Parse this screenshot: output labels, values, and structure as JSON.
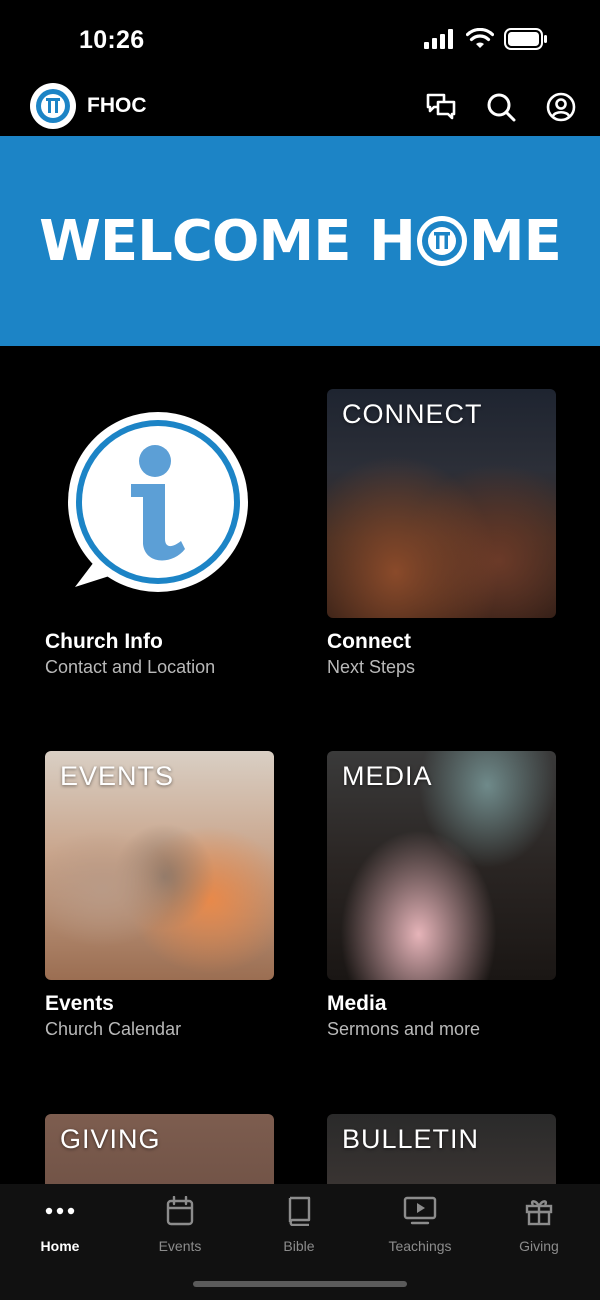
{
  "status_bar": {
    "time": "10:26"
  },
  "header": {
    "app_title": "FHOC",
    "icons": [
      "chat-icon",
      "search-icon",
      "profile-icon"
    ]
  },
  "banner": {
    "text_left": "WELCOME H",
    "text_right": "ME",
    "color": "#1c84c6"
  },
  "tiles": [
    {
      "overlay": "",
      "title": "Church Info",
      "subtitle": "Contact and Location"
    },
    {
      "overlay": "CONNECT",
      "title": "Connect",
      "subtitle": "Next Steps"
    },
    {
      "overlay": "EVENTS",
      "title": "Events",
      "subtitle": "Church Calendar"
    },
    {
      "overlay": "MEDIA",
      "title": "Media",
      "subtitle": "Sermons and more"
    },
    {
      "overlay": "GIVING",
      "title": "",
      "subtitle": ""
    },
    {
      "overlay": "BULLETIN",
      "title": "",
      "subtitle": ""
    }
  ],
  "tab_bar": {
    "tabs": [
      {
        "label": "Home",
        "icon": "more-dots-icon",
        "active": true
      },
      {
        "label": "Events",
        "icon": "calendar-icon",
        "active": false
      },
      {
        "label": "Bible",
        "icon": "book-icon",
        "active": false
      },
      {
        "label": "Teachings",
        "icon": "tv-play-icon",
        "active": false
      },
      {
        "label": "Giving",
        "icon": "gift-icon",
        "active": false
      }
    ]
  }
}
